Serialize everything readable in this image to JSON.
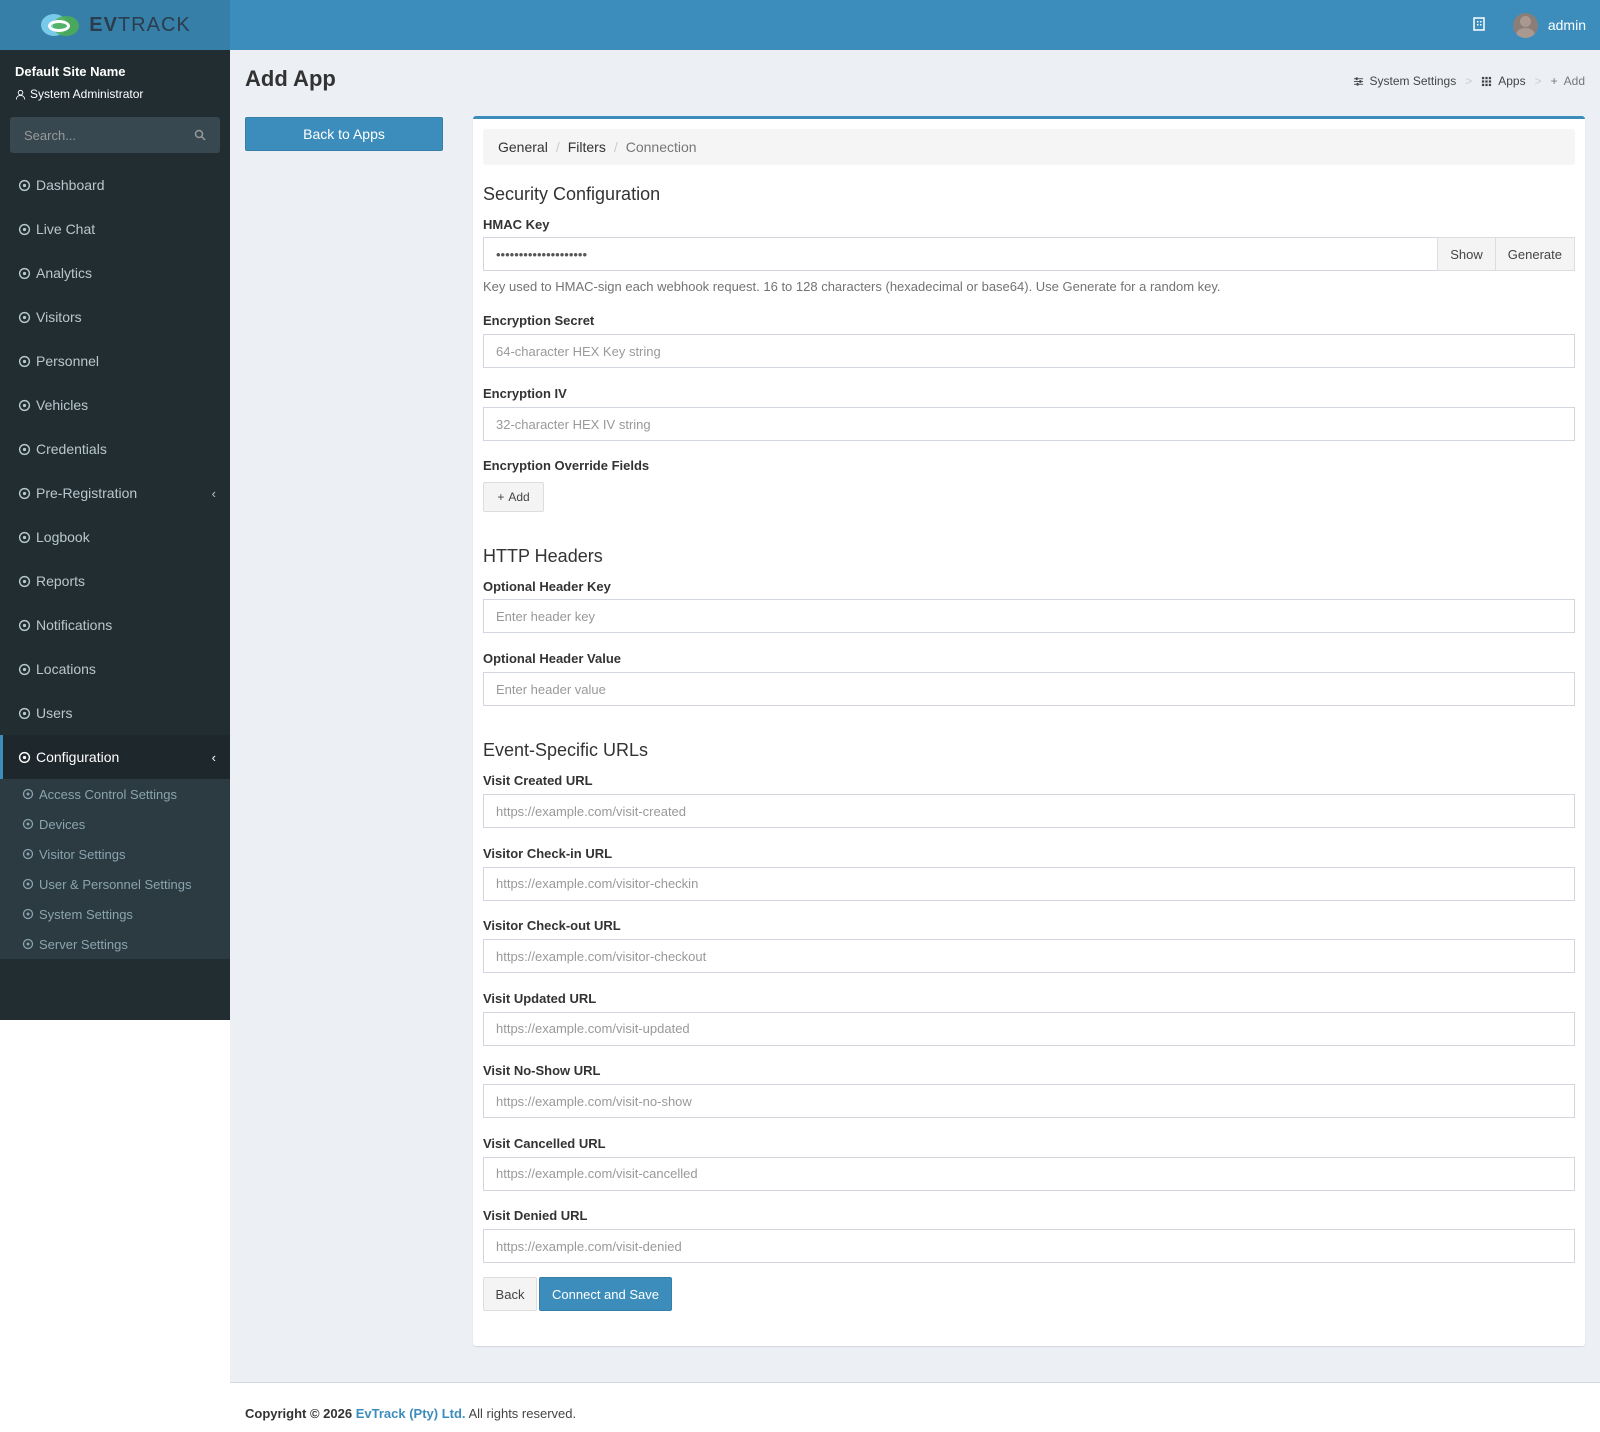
{
  "header": {
    "logo_strong": "EV",
    "logo_light": "TRACK",
    "user_name": "admin"
  },
  "sidebar": {
    "site_name": "Default Site Name",
    "role": "System Administrator",
    "search_placeholder": "Search...",
    "items": [
      {
        "label": "Dashboard",
        "icon": "gauge-icon"
      },
      {
        "label": "Live Chat",
        "icon": "headset-icon"
      },
      {
        "label": "Analytics",
        "icon": "target-icon"
      },
      {
        "label": "Visitors",
        "icon": "eye-icon"
      },
      {
        "label": "Personnel",
        "icon": "user-gear-icon"
      },
      {
        "label": "Vehicles",
        "icon": "car-icon"
      },
      {
        "label": "Credentials",
        "icon": "id-card-icon"
      },
      {
        "label": "Pre-Registration",
        "icon": "arrows-icon",
        "chevron": "‹"
      },
      {
        "label": "Logbook",
        "icon": "book-icon"
      },
      {
        "label": "Reports",
        "icon": "chart-area-icon"
      },
      {
        "label": "Notifications",
        "icon": "chat-icon"
      },
      {
        "label": "Locations",
        "icon": "map-icon"
      },
      {
        "label": "Users",
        "icon": "users-icon"
      },
      {
        "label": "Configuration",
        "icon": "cog-icon",
        "chevron": "‹"
      }
    ],
    "submenu": [
      {
        "label": "Access Control Settings",
        "icon": "lock-icon"
      },
      {
        "label": "Devices",
        "icon": "gear-icon"
      },
      {
        "label": "Visitor Settings",
        "icon": "eye-icon"
      },
      {
        "label": "User & Personnel Settings",
        "icon": "users-icon"
      },
      {
        "label": "System Settings",
        "icon": "sliders-icon"
      },
      {
        "label": "Server Settings",
        "icon": "wrench-icon"
      }
    ]
  },
  "page": {
    "title": "Add App",
    "breadcrumb": [
      "System Settings",
      "Apps",
      "Add"
    ],
    "back_to_apps": "Back to Apps"
  },
  "tabs": {
    "general": "General",
    "filters": "Filters",
    "connection": "Connection"
  },
  "security": {
    "heading": "Security Configuration",
    "hmac_label": "HMAC Key",
    "hmac_value": "••••••••••••••••••••",
    "show_btn": "Show",
    "generate_btn": "Generate",
    "hmac_help": "Key used to HMAC-sign each webhook request. 16 to 128 characters (hexadecimal or base64). Use Generate for a random key.",
    "secret_label": "Encryption Secret",
    "secret_placeholder": "64-character HEX Key string",
    "iv_label": "Encryption IV",
    "iv_placeholder": "32-character HEX IV string",
    "override_label": "Encryption Override Fields",
    "add_btn": "Add"
  },
  "headers": {
    "heading": "HTTP Headers",
    "key_label": "Optional Header Key",
    "key_placeholder": "Enter header key",
    "value_label": "Optional Header Value",
    "value_placeholder": "Enter header value"
  },
  "events": {
    "heading": "Event-Specific URLs",
    "fields": [
      {
        "label": "Visit Created URL",
        "placeholder": "https://example.com/visit-created"
      },
      {
        "label": "Visitor Check-in URL",
        "placeholder": "https://example.com/visitor-checkin"
      },
      {
        "label": "Visitor Check-out URL",
        "placeholder": "https://example.com/visitor-checkout"
      },
      {
        "label": "Visit Updated URL",
        "placeholder": "https://example.com/visit-updated"
      },
      {
        "label": "Visit No-Show URL",
        "placeholder": "https://example.com/visit-no-show"
      },
      {
        "label": "Visit Cancelled URL",
        "placeholder": "https://example.com/visit-cancelled"
      },
      {
        "label": "Visit Denied URL",
        "placeholder": "https://example.com/visit-denied"
      }
    ]
  },
  "actions": {
    "back": "Back",
    "connect_save": "Connect and Save"
  },
  "footer": {
    "copyright": "Copyright © 2026",
    "company": "EvTrack (Pty) Ltd.",
    "rights": "All rights reserved."
  },
  "colors": {
    "primary": "#3c8dbc",
    "sidebar_bg": "#222d32",
    "content_bg": "#ecf0f5"
  }
}
